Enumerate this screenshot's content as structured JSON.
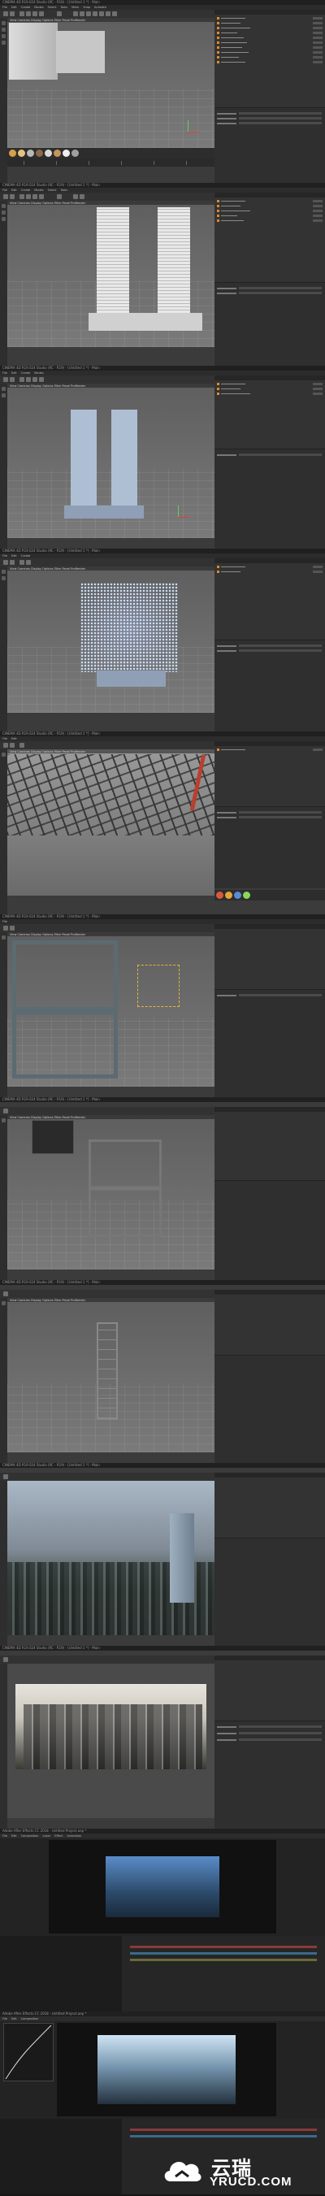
{
  "app": {
    "title": "CINEMA 4D R19.024 Studio (RC - R19) - [Untitled 1 *] - Main",
    "menus": [
      "File",
      "Edit",
      "Create",
      "Modes",
      "Select",
      "Tools",
      "Mesh",
      "Snap",
      "Animate",
      "Simulate",
      "Tracker",
      "Render",
      "Sculpt",
      "Motion Tracker",
      "MoGraph",
      "Character",
      "Pipeline",
      "Plugins",
      "Script",
      "Window",
      "Help"
    ],
    "viewport_menu": "View  Cameras  Display  Options  Filter  Panel  ProRender"
  },
  "after_effects": {
    "title": "Adobe After Effects CC 2018 - Untitled Project.aep *",
    "menus": [
      "File",
      "Edit",
      "Composition",
      "Layer",
      "Effect",
      "Animation",
      "View",
      "Window",
      "Help"
    ]
  },
  "watermark": {
    "chinese": "云瑞",
    "domain": "YRUCD.COM"
  },
  "colors": {
    "c4d_bg": "#3b3b3b",
    "viewport": "#6b6b6b",
    "accent_orange": "#e08a2e",
    "ae_bg": "#232323"
  }
}
